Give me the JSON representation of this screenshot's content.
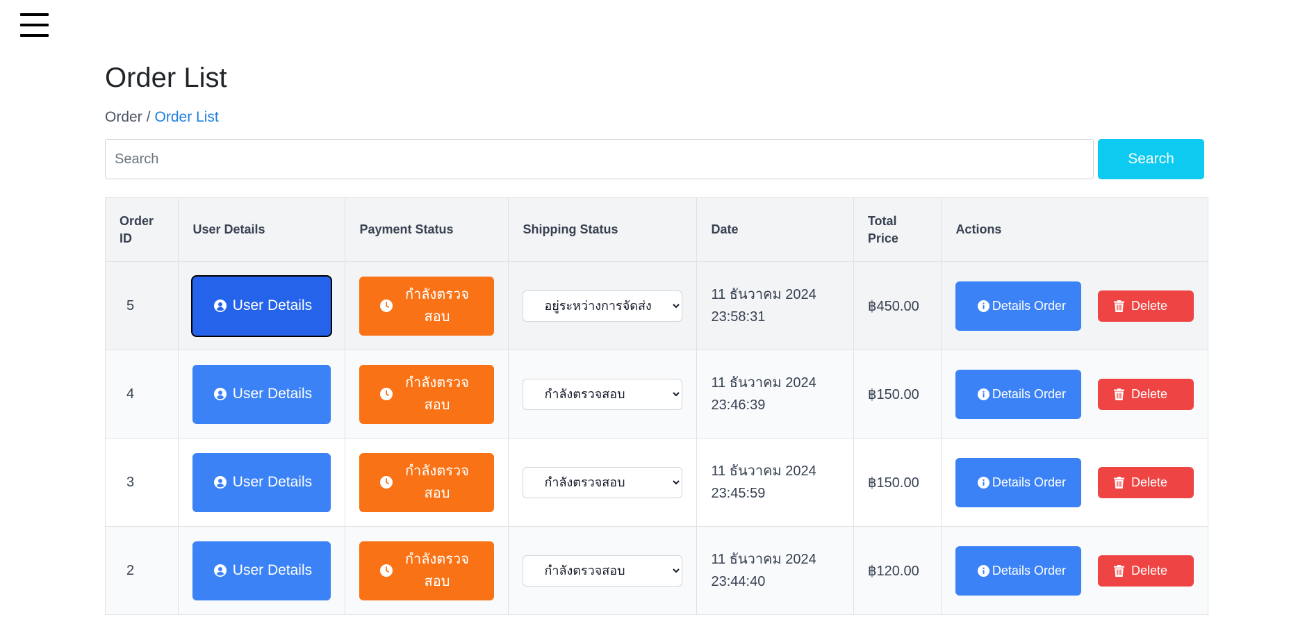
{
  "page": {
    "title": "Order List",
    "breadcrumb": {
      "parent": "Order",
      "separator": "/",
      "current": "Order List"
    }
  },
  "search": {
    "placeholder": "Search",
    "value": "",
    "button_label": "Search"
  },
  "table": {
    "headers": {
      "order_id": "Order ID",
      "user_details": "User Details",
      "payment_status": "Payment Status",
      "shipping_status": "Shipping Status",
      "date": "Date",
      "total_price": "Total Price",
      "actions": "Actions"
    },
    "rows": [
      {
        "order_id": "5",
        "user_button": "User Details",
        "payment_status": "กำลังตรวจสอบ",
        "shipping_status": "อยู่ระหว่างการจัดส่ง",
        "date": "11 ธันวาคม 2024 23:58:31",
        "total_price": "฿450.00",
        "details_button": "Details Order",
        "delete_button": "Delete",
        "focused": true
      },
      {
        "order_id": "4",
        "user_button": "User Details",
        "payment_status": "กำลังตรวจสอบ",
        "shipping_status": "กำลังตรวจสอบ",
        "date": "11 ธันวาคม 2024 23:46:39",
        "total_price": "฿150.00",
        "details_button": "Details Order",
        "delete_button": "Delete",
        "focused": false
      },
      {
        "order_id": "3",
        "user_button": "User Details",
        "payment_status": "กำลังตรวจสอบ",
        "shipping_status": "กำลังตรวจสอบ",
        "date": "11 ธันวาคม 2024 23:45:59",
        "total_price": "฿150.00",
        "details_button": "Details Order",
        "delete_button": "Delete",
        "focused": false
      },
      {
        "order_id": "2",
        "user_button": "User Details",
        "payment_status": "กำลังตรวจสอบ",
        "shipping_status": "กำลังตรวจสอบ",
        "date": "11 ธันวาคม 2024 23:44:40",
        "total_price": "฿120.00",
        "details_button": "Details Order",
        "delete_button": "Delete",
        "focused": false
      }
    ]
  },
  "icons": {
    "menu": "hamburger-menu-icon",
    "user": "user-circle-icon",
    "payment": "clock-icon",
    "details": "info-circle-icon",
    "delete": "trash-icon"
  },
  "colors": {
    "primary": "#3b82f6",
    "primary_focused": "#2563eb",
    "warning": "#f97316",
    "danger": "#ef4444",
    "info": "#0dcaf0",
    "link": "#1d7fe0"
  }
}
